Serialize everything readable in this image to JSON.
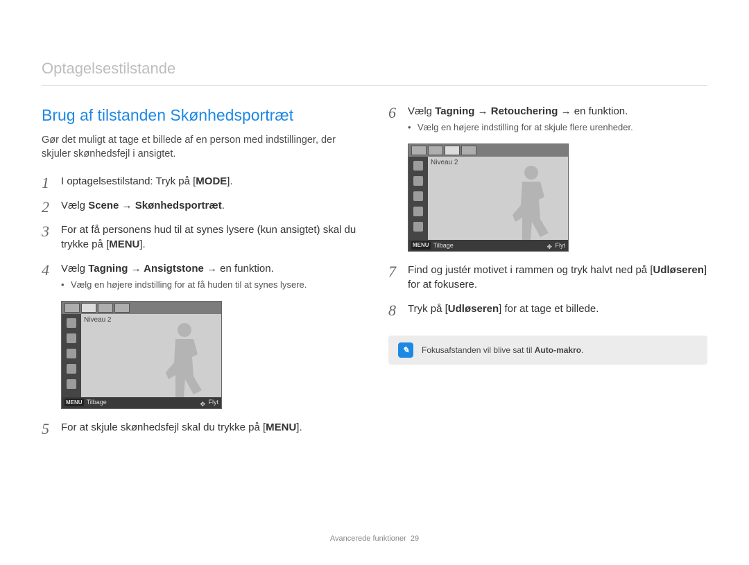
{
  "breadcrumb": "Optagelsestilstande",
  "title": "Brug af tilstanden Skønhedsportræt",
  "intro": "Gør det muligt at tage et billede af en person med indstillinger, der skjuler skønhedsfejl i ansigtet.",
  "steps_left": {
    "s1_a": "I optagelsestilstand: Tryk på [",
    "s1_key": "MODE",
    "s1_b": "].",
    "s2_a": "Vælg ",
    "s2_bold": "Scene → Skønhedsportræt",
    "s2_b": ".",
    "s3_a": "For at få personens hud til at synes lysere (kun ansigtet) skal du trykke på [",
    "s3_key": "MENU",
    "s3_b": "].",
    "s4_a": "Vælg ",
    "s4_bold": "Tagning → Ansigtstone",
    "s4_b": " → en funktion.",
    "s4_sub": "Vælg en højere indstilling for at få huden til at synes lysere.",
    "s5_a": "For at skjule skønhedsfejl skal du trykke på [",
    "s5_key": "MENU",
    "s5_b": "]."
  },
  "steps_right": {
    "s6_a": "Vælg ",
    "s6_bold": "Tagning → Retouchering",
    "s6_b": " → en funktion.",
    "s6_sub": "Vælg en højere indstilling for at skjule flere urenheder.",
    "s7_a": "Find og justér motivet i rammen og tryk halvt ned på [",
    "s7_bold": "Udløseren",
    "s7_b": "] for at fokusere.",
    "s8_a": "Tryk på [",
    "s8_bold": "Udløseren",
    "s8_b": "] for at tage et billede."
  },
  "camera": {
    "level_label": "Niveau 2",
    "menu_icon_text": "MENU",
    "back_label": "Tilbage",
    "move_label": "Flyt"
  },
  "note": {
    "icon_glyph": "✎",
    "text_a": "Fokusafstanden vil blive sat til ",
    "text_bold": "Auto-makro",
    "text_b": "."
  },
  "footer": {
    "label": "Avancerede funktioner",
    "page": "29"
  }
}
